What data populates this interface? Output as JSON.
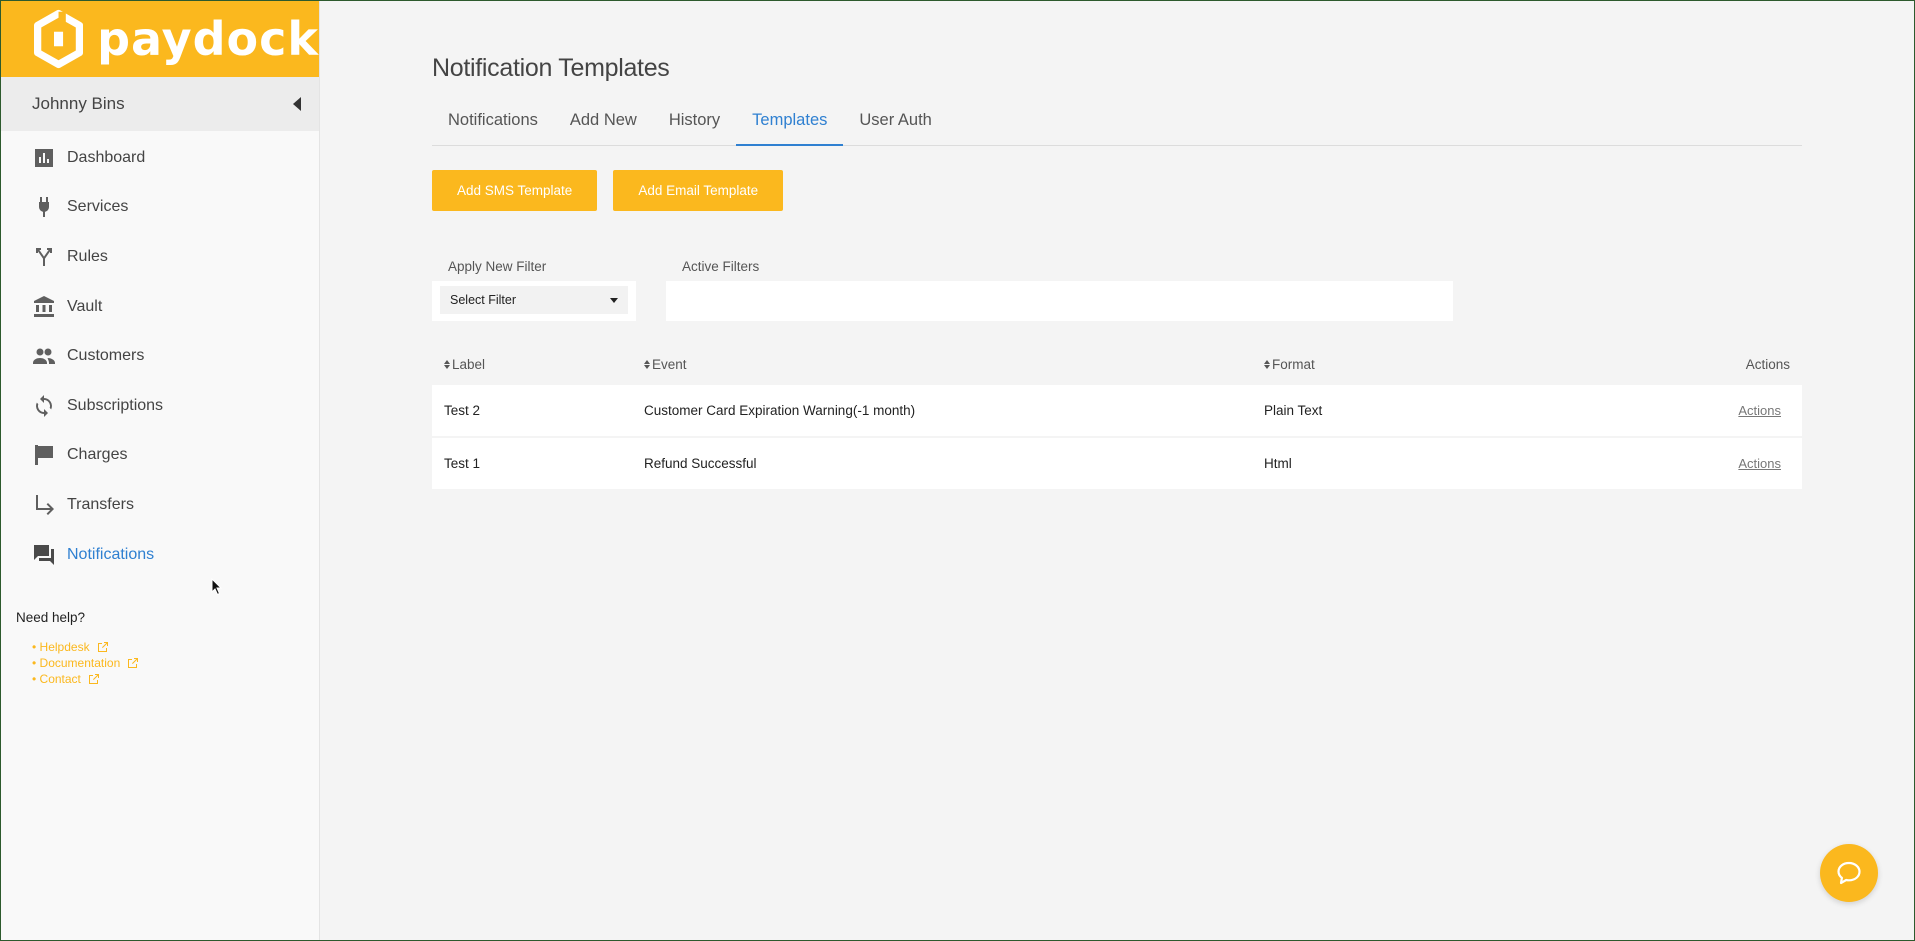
{
  "brand": {
    "name": "paydock",
    "color": "#fbb81e"
  },
  "user": {
    "name": "Johnny Bins"
  },
  "sidebar": {
    "items": [
      {
        "label": "Dashboard",
        "icon": "bar-chart-icon"
      },
      {
        "label": "Services",
        "icon": "plug-icon"
      },
      {
        "label": "Rules",
        "icon": "fork-icon"
      },
      {
        "label": "Vault",
        "icon": "bank-icon"
      },
      {
        "label": "Customers",
        "icon": "people-icon"
      },
      {
        "label": "Subscriptions",
        "icon": "sync-icon"
      },
      {
        "label": "Charges",
        "icon": "flag-icon"
      },
      {
        "label": "Transfers",
        "icon": "subdirectory-arrow-icon"
      },
      {
        "label": "Notifications",
        "icon": "forum-icon",
        "active": true
      }
    ],
    "help": {
      "title": "Need help?",
      "links": [
        "• Helpdesk",
        "• Documentation",
        "• Contact"
      ]
    }
  },
  "main": {
    "title": "Notification Templates",
    "tabs": [
      "Notifications",
      "Add New",
      "History",
      "Templates",
      "User Auth"
    ],
    "active_tab": "Templates",
    "buttons": {
      "add_sms": "Add SMS Template",
      "add_email": "Add Email Template"
    },
    "filters": {
      "apply_label": "Apply New Filter",
      "select_value": "Select Filter",
      "active_label": "Active Filters"
    },
    "table": {
      "columns": {
        "label": "Label",
        "event": "Event",
        "format": "Format",
        "actions": "Actions"
      },
      "rows": [
        {
          "label": "Test 2",
          "event": "Customer Card Expiration Warning(-1 month)",
          "format": "Plain Text",
          "action": "Actions"
        },
        {
          "label": "Test 1",
          "event": "Refund Successful",
          "format": "Html",
          "action": "Actions"
        }
      ]
    }
  },
  "colors": {
    "accent": "#fbb81e",
    "link_active": "#2f80d1"
  }
}
